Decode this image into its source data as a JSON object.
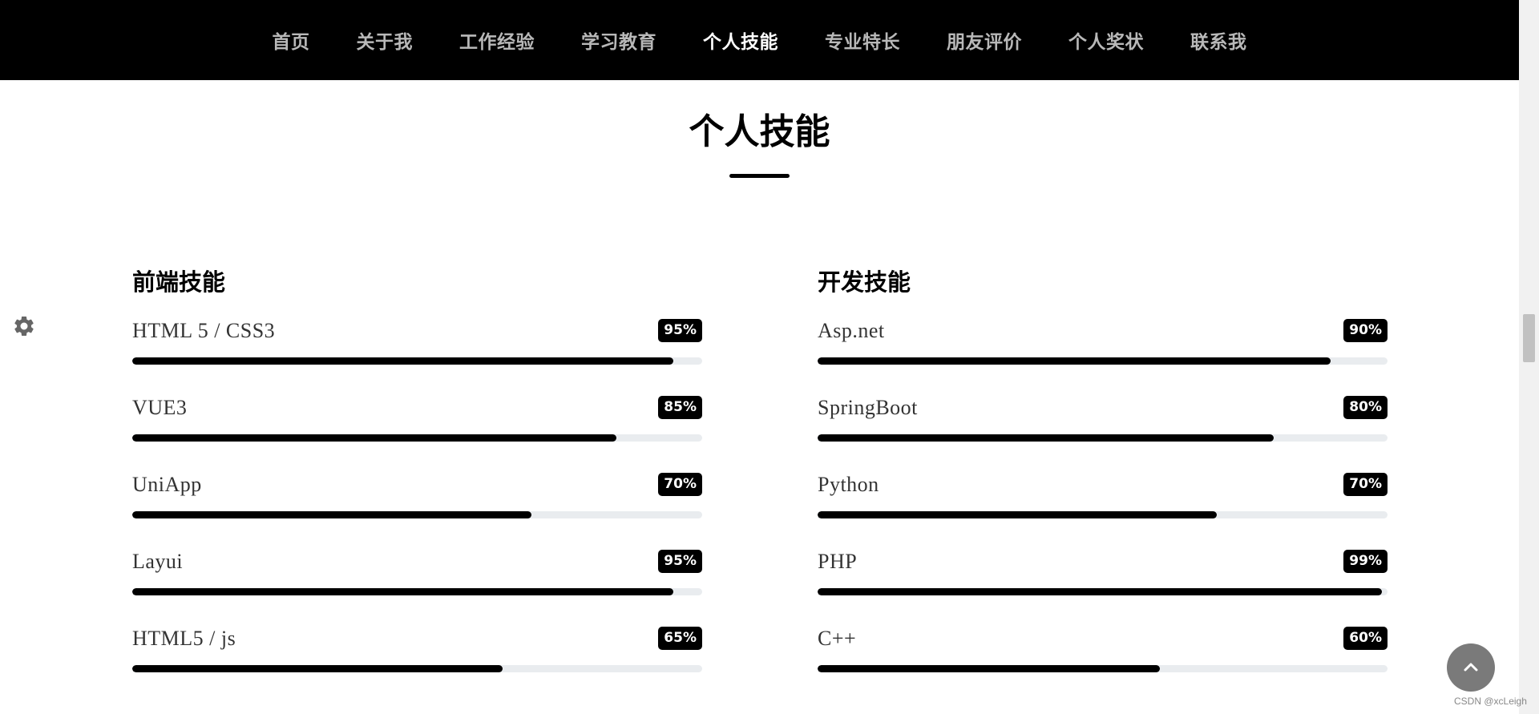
{
  "nav": {
    "items": [
      {
        "label": "首页",
        "active": false
      },
      {
        "label": "关于我",
        "active": false
      },
      {
        "label": "工作经验",
        "active": false
      },
      {
        "label": "学习教育",
        "active": false
      },
      {
        "label": "个人技能",
        "active": true
      },
      {
        "label": "专业特长",
        "active": false
      },
      {
        "label": "朋友评价",
        "active": false
      },
      {
        "label": "个人奖状",
        "active": false
      },
      {
        "label": "联系我",
        "active": false
      }
    ]
  },
  "section": {
    "title": "个人技能"
  },
  "frontend": {
    "heading": "前端技能",
    "skills": [
      {
        "name": "HTML 5 / CSS3",
        "percent_label": "95%",
        "percent": 95
      },
      {
        "name": "VUE3",
        "percent_label": "85%",
        "percent": 85
      },
      {
        "name": "UniApp",
        "percent_label": "70%",
        "percent": 70
      },
      {
        "name": "Layui",
        "percent_label": "95%",
        "percent": 95
      },
      {
        "name": "HTML5 / js",
        "percent_label": "65%",
        "percent": 65
      }
    ]
  },
  "backend": {
    "heading": "开发技能",
    "skills": [
      {
        "name": "Asp.net",
        "percent_label": "90%",
        "percent": 90
      },
      {
        "name": "SpringBoot",
        "percent_label": "80%",
        "percent": 80
      },
      {
        "name": "Python",
        "percent_label": "70%",
        "percent": 70
      },
      {
        "name": "PHP",
        "percent_label": "99%",
        "percent": 99
      },
      {
        "name": "C++",
        "percent_label": "60%",
        "percent": 60
      }
    ]
  },
  "icons": {
    "settings": "gear-icon",
    "back_to_top": "chevron-up-icon"
  },
  "colors": {
    "nav_bg": "#000000",
    "nav_text": "#b8b8b8",
    "nav_active": "#ffffff",
    "bar_fill": "#000000",
    "bar_track": "#e9ecef",
    "badge_bg": "#000000"
  },
  "watermark": "CSDN @xcLeigh"
}
